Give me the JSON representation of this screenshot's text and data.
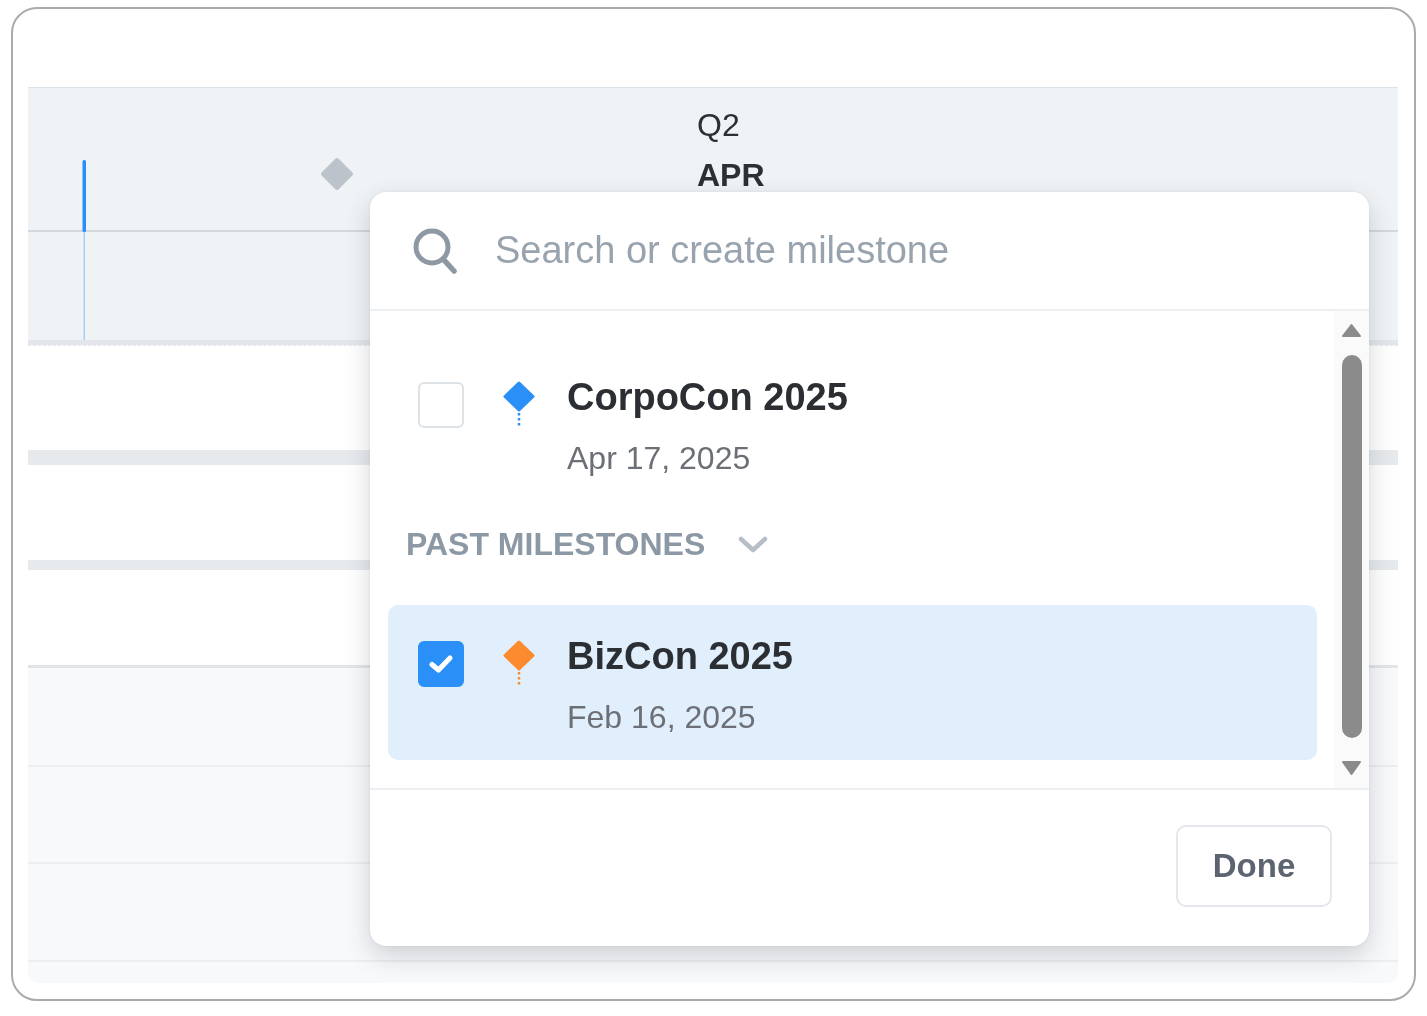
{
  "timeline": {
    "quarter": "Q2",
    "month": "APR"
  },
  "milestone_picker": {
    "search": {
      "placeholder": "Search or create milestone"
    },
    "milestones": [
      {
        "name": "CorpoCon 2025",
        "date": "Apr 17, 2025",
        "color": "#2b8ff8",
        "checked": false,
        "selected": false
      }
    ],
    "past_milestones": {
      "label": "PAST MILESTONES",
      "expanded": true,
      "milestones": [
        {
          "name": "BizCon 2025",
          "date": "Feb 16, 2025",
          "color": "#fb8b2e",
          "checked": true,
          "selected": true
        }
      ]
    },
    "done_button": {
      "label": "Done"
    }
  }
}
